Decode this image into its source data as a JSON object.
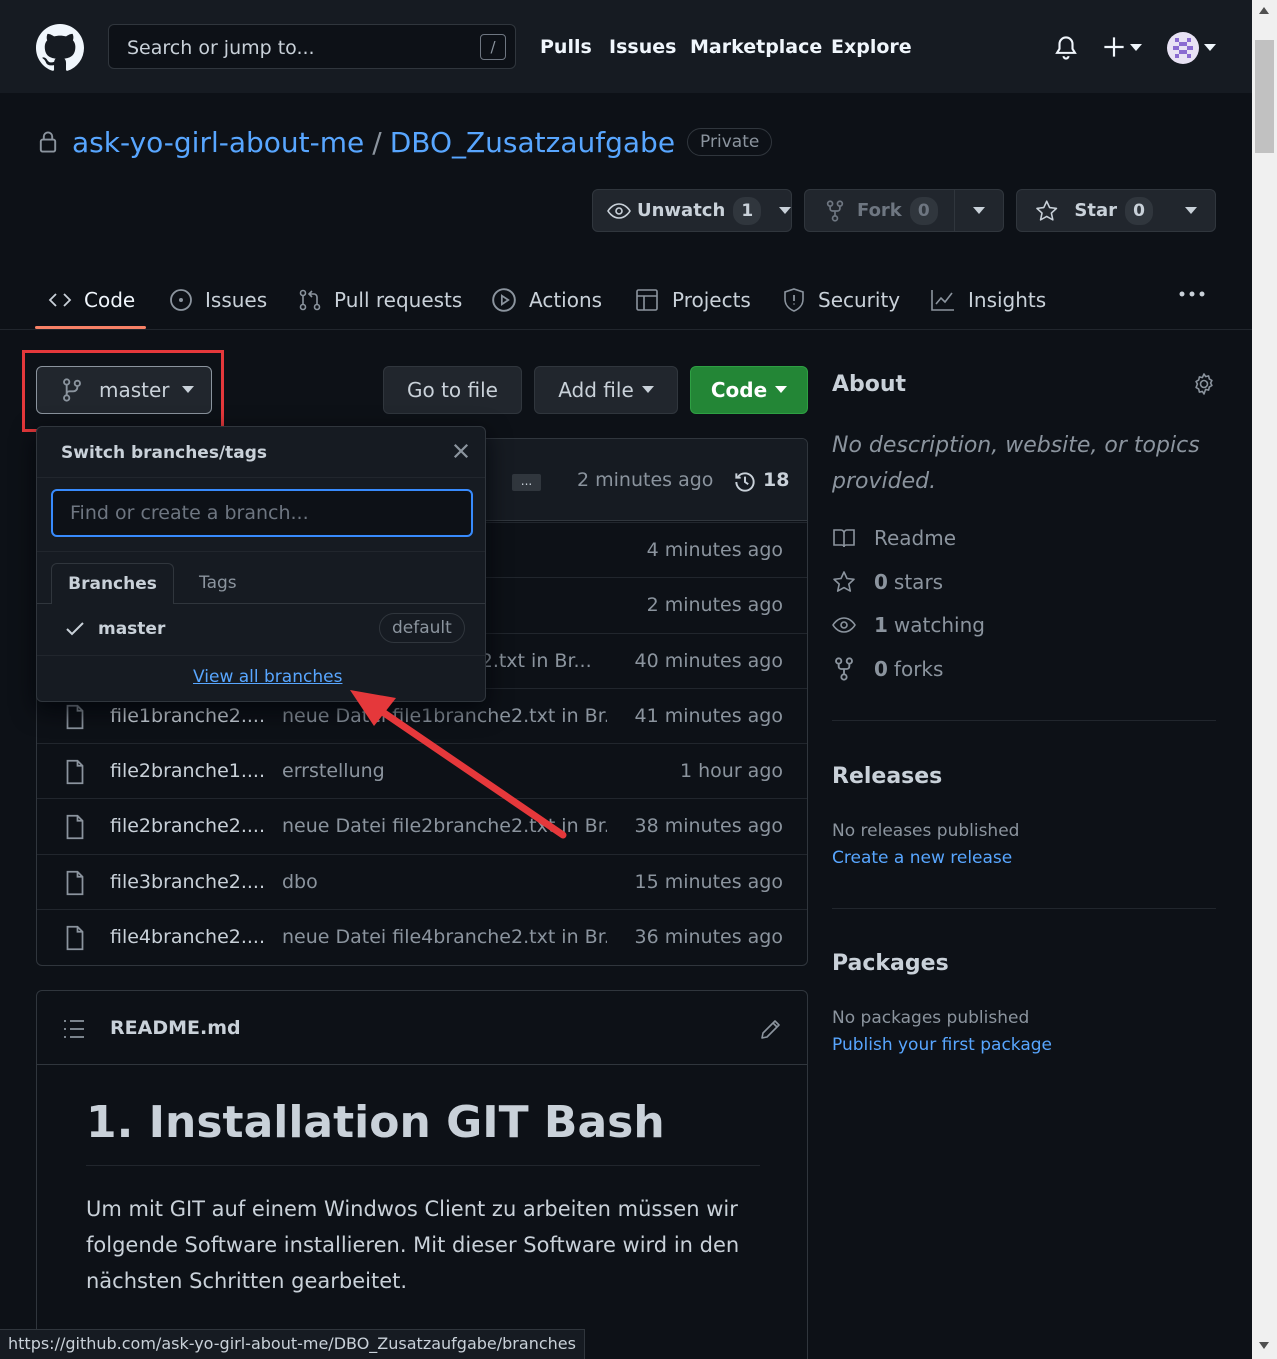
{
  "header": {
    "search_placeholder": "Search or jump to...",
    "search_key": "/",
    "nav": [
      "Pulls",
      "Issues",
      "Marketplace",
      "Explore"
    ]
  },
  "repo": {
    "owner": "ask-yo-girl-about-me",
    "separator": "/",
    "name": "DBO_Zusatzaufgabe",
    "visibility": "Private"
  },
  "actions": {
    "unwatch_label": "Unwatch",
    "watch_count": "1",
    "fork_label": "Fork",
    "fork_count": "0",
    "star_label": "Star",
    "star_count": "0"
  },
  "tabs": [
    "Code",
    "Issues",
    "Pull requests",
    "Actions",
    "Projects",
    "Security",
    "Insights"
  ],
  "toolbar": {
    "branch": "master",
    "go_to_file": "Go to file",
    "add_file": "Add file",
    "code": "Code"
  },
  "commit_bar": {
    "ellipsis": "...",
    "time": "2 minutes ago",
    "commits": "18"
  },
  "files": [
    {
      "name": "",
      "message": "",
      "time": "4 minutes ago"
    },
    {
      "name": "",
      "message": "",
      "time": "2 minutes ago"
    },
    {
      "name": "",
      "message": "he2.txt in Br...",
      "time": "40 minutes ago"
    },
    {
      "name": "file1branche2....",
      "message": "neue Datei file1branche2.txt in Br...",
      "time": "41 minutes ago"
    },
    {
      "name": "file2branche1....",
      "message": "errstellung",
      "time": "1 hour ago"
    },
    {
      "name": "file2branche2....",
      "message": "neue Datei file2branche2.txt in Br...",
      "time": "38 minutes ago"
    },
    {
      "name": "file3branche2....",
      "message": "dbo",
      "time": "15 minutes ago"
    },
    {
      "name": "file4branche2....",
      "message": "neue Datei file4branche2.txt in Br...",
      "time": "36 minutes ago"
    }
  ],
  "dropdown": {
    "title": "Switch branches/tags",
    "input_placeholder": "Find or create a branch...",
    "tab_branches": "Branches",
    "tab_tags": "Tags",
    "branch_name": "master",
    "default_badge": "default",
    "view_all": "View all branches"
  },
  "sidebar": {
    "about_title": "About",
    "description": "No description, website, or topics provided.",
    "readme": "Readme",
    "stars_count": "0",
    "stars_label": "stars",
    "watching_count": "1",
    "watching_label": "watching",
    "forks_count": "0",
    "forks_label": "forks",
    "releases_title": "Releases",
    "releases_text": "No releases published",
    "releases_link": "Create a new release",
    "packages_title": "Packages",
    "packages_text": "No packages published",
    "packages_link": "Publish your first package"
  },
  "readme": {
    "filename": "README.md",
    "heading": "1. Installation GIT Bash",
    "paragraph": "Um mit GIT auf einem Windwos Client zu arbeiten müssen wir folgende Software installieren. Mit dieser Software wird in den nächsten Schritten gearbeitet."
  },
  "status_url": "https://github.com/ask-yo-girl-about-me/DBO_Zusatzaufgabe/branches",
  "colors": {
    "background": "#0d1117",
    "header": "#161b22",
    "link": "#58a6ff",
    "green_button": "#238636",
    "tab_underline": "#f78166",
    "annotation_red": "#e5383b"
  }
}
